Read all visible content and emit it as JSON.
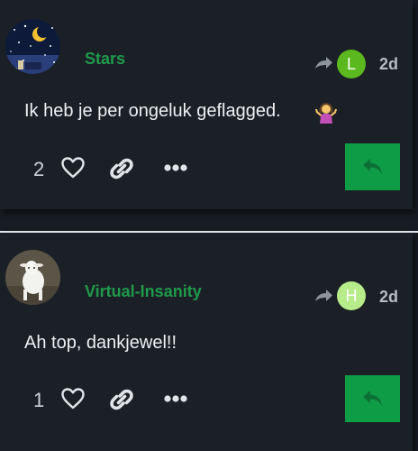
{
  "posts": [
    {
      "username": "Stars",
      "reply_to_avatar_letter": "L",
      "reply_to_avatar_color": "#5bb81e",
      "date": "2d",
      "body": "Ik heb je per ongeluk geflagged.",
      "emoji": "woman-shrugging-emoji",
      "like_count": "2",
      "avatar": "night-sky-moon-avatar"
    },
    {
      "username": "Virtual-Insanity",
      "reply_to_avatar_letter": "H",
      "reply_to_avatar_color": "#b7ec8a",
      "date": "2d",
      "body": "Ah top, dankjewel!!",
      "like_count": "1",
      "avatar": "goat-photo-avatar"
    }
  ],
  "colors": {
    "background": "#171c22",
    "card": "#1b2027",
    "username": "#1f9a4a",
    "reply_button": "#0f9c47"
  }
}
